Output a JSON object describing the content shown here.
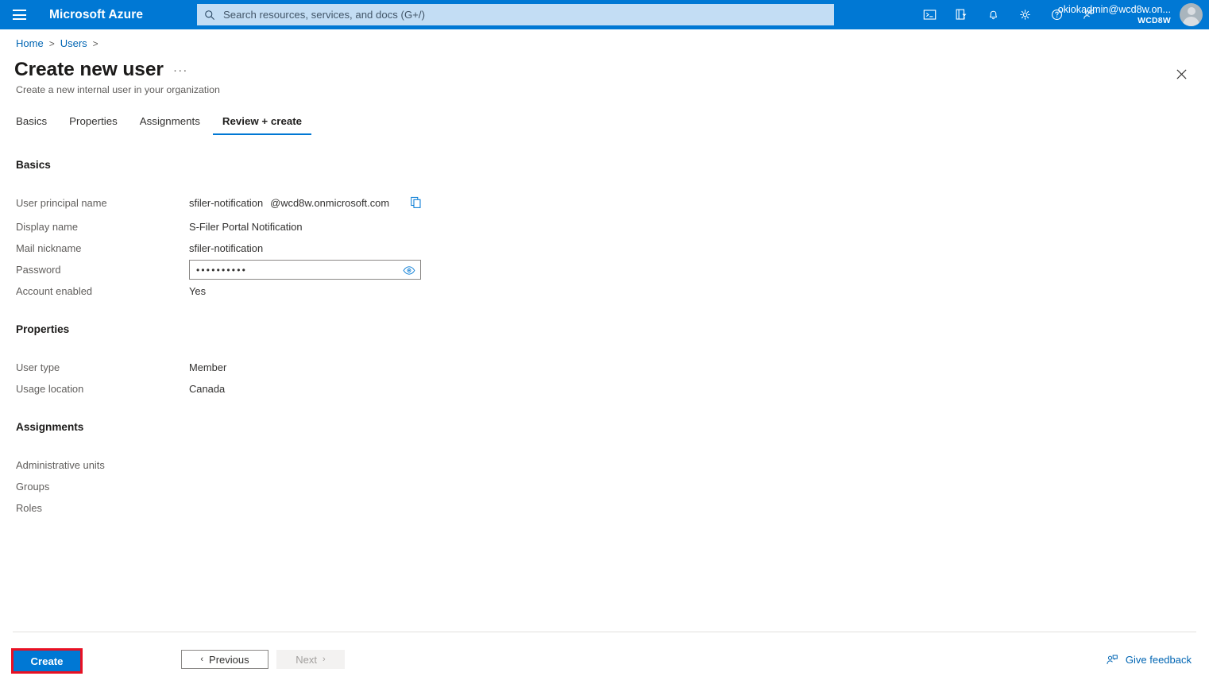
{
  "header": {
    "brand": "Microsoft Azure",
    "menu_icon": "hamburger-icon",
    "search": {
      "placeholder": "Search resources, services, and docs (G+/)",
      "value": "",
      "icon": "search-icon"
    },
    "icons": [
      {
        "name": "cloud-shell-icon",
        "title": "Cloud Shell"
      },
      {
        "name": "directories-subscriptions-icon",
        "title": "Directories + subscriptions"
      },
      {
        "name": "notifications-bell-icon",
        "title": "Notifications"
      },
      {
        "name": "settings-gear-icon",
        "title": "Settings"
      },
      {
        "name": "help-question-icon",
        "title": "Help"
      },
      {
        "name": "feedback-person-icon",
        "title": "Feedback"
      }
    ],
    "account": {
      "name": "okiokadmin@wcd8w.on...",
      "org": "WCD8W",
      "avatar": "user-avatar"
    }
  },
  "breadcrumb": {
    "items": [
      "Home",
      "Users"
    ],
    "separator": ">"
  },
  "page": {
    "title": "Create new user",
    "ellipsis": "···",
    "subtitle": "Create a new internal user in your organization",
    "close_icon": "close-icon"
  },
  "tabs": [
    {
      "label": "Basics",
      "active": false
    },
    {
      "label": "Properties",
      "active": false
    },
    {
      "label": "Assignments",
      "active": false
    },
    {
      "label": "Review + create",
      "active": true
    }
  ],
  "sections": {
    "basics": {
      "heading": "Basics",
      "rows": [
        {
          "label": "User principal name",
          "value": ""
        },
        {
          "label": "Display name",
          "value": "S-Filer Portal Notification"
        },
        {
          "label": "Mail nickname",
          "value": "sfiler-notification"
        },
        {
          "label": "Password",
          "value": ""
        },
        {
          "label": "Account enabled",
          "value": "Yes"
        }
      ],
      "upn": {
        "local": "sfiler-notification",
        "domain": "@wcd8w.onmicrosoft.com",
        "copy_icon": "copy-icon"
      },
      "password": {
        "masked": "••••••••••",
        "reveal_icon": "eye-icon"
      }
    },
    "properties": {
      "heading": "Properties",
      "rows": [
        {
          "label": "User type",
          "value": "Member"
        },
        {
          "label": "Usage location",
          "value": "Canada"
        }
      ]
    },
    "assignments": {
      "heading": "Assignments",
      "rows": [
        {
          "label": "Administrative units",
          "value": ""
        },
        {
          "label": "Groups",
          "value": ""
        },
        {
          "label": "Roles",
          "value": ""
        }
      ]
    }
  },
  "footer": {
    "create_label": "Create",
    "previous_label": "Previous",
    "next_label": "Next",
    "prev_chevron": "‹",
    "next_chevron": "›",
    "feedback_label": "Give feedback",
    "feedback_icon": "feedback-person-icon"
  },
  "colors": {
    "azure_blue": "#0078d4",
    "search_bg": "#c3ddf4",
    "link_blue": "#0065b3",
    "highlight_red": "#e81123",
    "label_gray": "#605e5c",
    "text_dark": "#323130"
  }
}
